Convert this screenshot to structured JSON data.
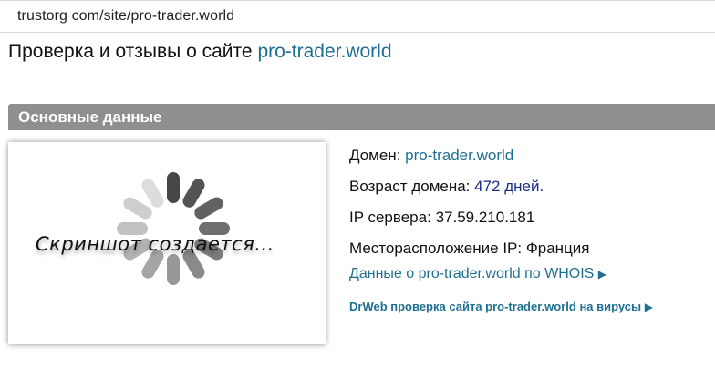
{
  "browser": {
    "url": "trustorg com/site/pro-trader.world"
  },
  "page": {
    "heading_prefix": "Проверка и отзывы о сайте",
    "heading_site": "pro-trader.world"
  },
  "section": {
    "title": "Основные данные"
  },
  "screenshot": {
    "caption": "Скриншот создается..."
  },
  "info": {
    "domain_label": "Домен:",
    "domain_value": "pro-trader.world",
    "age_label": "Возраст домена:",
    "age_value": "472 дней.",
    "ip_label": "IP сервера:",
    "ip_value": "37.59.210.181",
    "location_label": "Месторасположение IP:",
    "location_value": "Франция"
  },
  "links": {
    "whois_text": "Данные о pro-trader.world по WHOIS",
    "drweb_text": "DrWeb проверка сайта pro-trader.world на вирусы",
    "arrow": "▶"
  },
  "icons": {
    "spinner": "loading-spinner-icon",
    "arrow": "triangle-right-icon"
  },
  "colors": {
    "link": "#1f6f92",
    "age_value": "#1a2f8a",
    "section_bar": "#8f8f8f"
  }
}
